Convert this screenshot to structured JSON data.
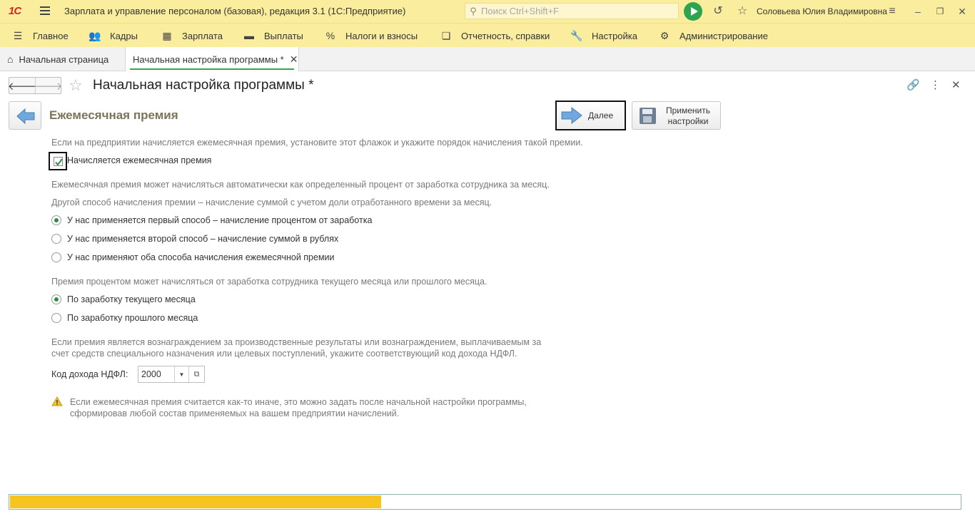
{
  "titlebar": {
    "logo": "1С",
    "title": "Зарплата и управление персоналом (базовая), редакция 3.1  (1С:Предприятие)",
    "search_placeholder": "Поиск Ctrl+Shift+F",
    "user": "Соловьева Юлия Владимировна"
  },
  "menu": {
    "items": [
      {
        "label": "Главное",
        "icon": "hamburger-icon"
      },
      {
        "label": "Кадры",
        "icon": "people-icon"
      },
      {
        "label": "Зарплата",
        "icon": "calculator-icon"
      },
      {
        "label": "Выплаты",
        "icon": "wallet-icon"
      },
      {
        "label": "Налоги и взносы",
        "icon": "percent-icon"
      },
      {
        "label": "Отчетность, справки",
        "icon": "report-icon"
      },
      {
        "label": "Настройка",
        "icon": "wrench-icon"
      },
      {
        "label": "Администрирование",
        "icon": "gear-icon"
      }
    ]
  },
  "tabs": [
    {
      "label": "Начальная страница",
      "active": false
    },
    {
      "label": "Начальная настройка программы *",
      "active": true
    }
  ],
  "form": {
    "title": "Начальная настройка программы *",
    "step_title": "Ежемесячная премия",
    "next_label": "Далее",
    "apply_label_1": "Применить",
    "apply_label_2": "настройки"
  },
  "content": {
    "intro": "Если на предприятии начисляется ежемесячная премия, установите этот флажок и укажите порядок начисления такой премии.",
    "checkbox_label": "Начисляется ежемесячная премия",
    "checkbox_checked": true,
    "method_text_1": "Ежемесячная премия может начисляться автоматически как определенный процент от заработка сотрудника за месяц.",
    "method_text_2": "Другой способ начисления премии – начисление суммой с учетом доли отработанного времени за месяц.",
    "method_options": [
      {
        "label": "У нас применяется первый способ – начисление процентом от заработка",
        "selected": true
      },
      {
        "label": "У нас применяется второй способ – начисление суммой в рублях",
        "selected": false
      },
      {
        "label": "У нас применяют оба способа начисления ежемесячной премии",
        "selected": false
      }
    ],
    "period_text": "Премия процентом может начисляться от заработка сотрудника текущего месяца или прошлого месяца.",
    "period_options": [
      {
        "label": "По заработку текущего месяца",
        "selected": true
      },
      {
        "label": "По заработку прошлого месяца",
        "selected": false
      }
    ],
    "ndfl_text_1": "Если премия является вознаграждением за производственные результаты или вознаграждением, выплачиваемым за",
    "ndfl_text_2": "счет средств специального назначения или целевых поступлений, укажите соответствующий код дохода НДФЛ.",
    "ndfl_label": "Код дохода НДФЛ:",
    "ndfl_value": "2000",
    "warning_1": "Если ежемесячная премия считается как-то иначе, это можно задать после начальной настройки программы,",
    "warning_2": "сформировав любой состав применяемых на вашем предприятии начислений."
  },
  "progress": {
    "fraction": 0.39,
    "color": "#f7c31f"
  }
}
